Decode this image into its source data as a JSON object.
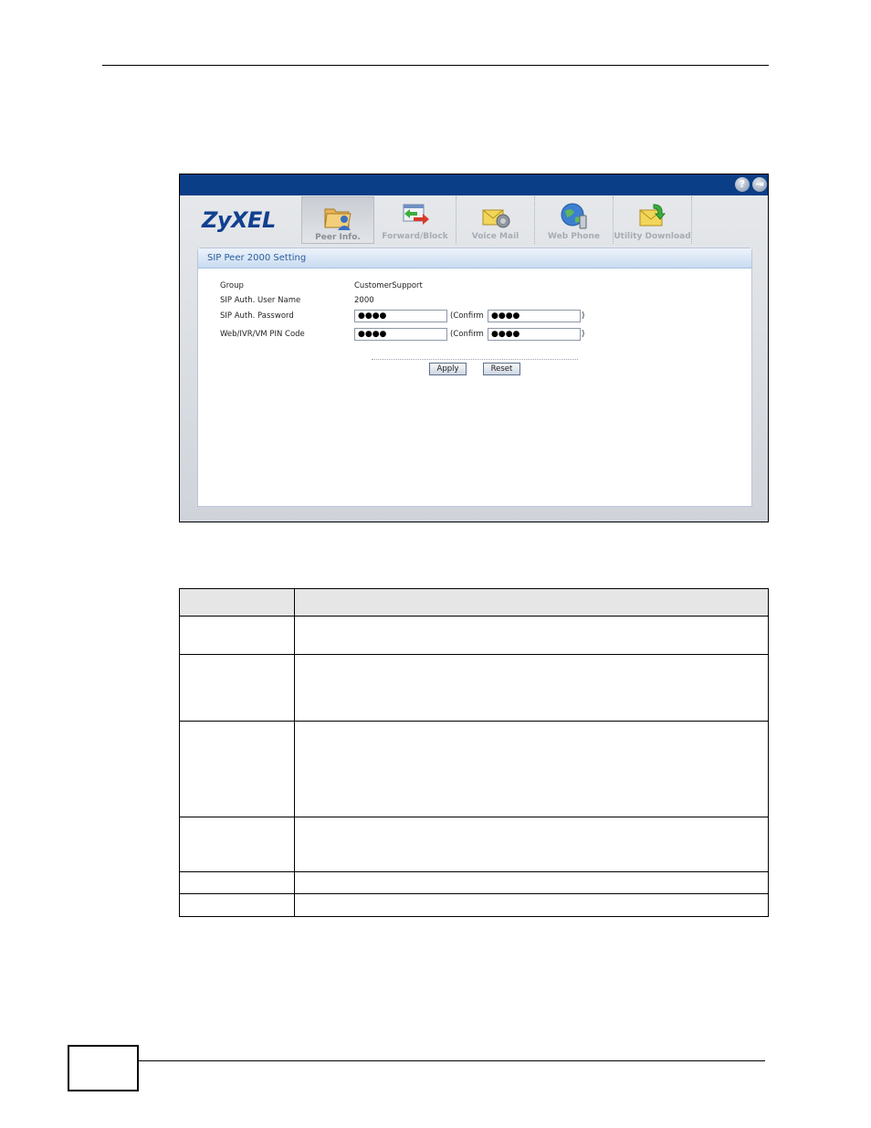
{
  "app": {
    "logo": "ZyXEL",
    "help_icon": "question-icon",
    "logout_icon": "logout-icon"
  },
  "tabs": [
    {
      "label": "Peer Info.",
      "icon": "folder-user-icon",
      "active": true
    },
    {
      "label": "Forward/Block",
      "icon": "forward-block-icon",
      "active": false
    },
    {
      "label": "Voice Mail",
      "icon": "voice-mail-icon",
      "active": false
    },
    {
      "label": "Web Phone",
      "icon": "globe-phone-icon",
      "active": false
    },
    {
      "label": "Utility Download",
      "icon": "download-mail-icon",
      "active": false
    }
  ],
  "panel": {
    "title": "SIP Peer 2000 Setting",
    "fields": {
      "group_label": "Group",
      "group_value": "CustomerSupport",
      "user_label": "SIP Auth. User Name",
      "user_value": "2000",
      "password_label": "SIP Auth. Password",
      "password_value": "●●●●",
      "password_confirm_label": "(Confirm",
      "password_confirm_value": "●●●●",
      "pin_label": "Web/IVR/VM PIN Code",
      "pin_value": "●●●●",
      "pin_confirm_label": "(Confirm",
      "pin_confirm_value": "●●●●",
      "close_paren": ")"
    },
    "apply_label": "Apply",
    "reset_label": "Reset"
  },
  "colors": {
    "topbar": "#0a3e86",
    "logo": "#12408f",
    "panel_header_text": "#2d5e9b"
  }
}
